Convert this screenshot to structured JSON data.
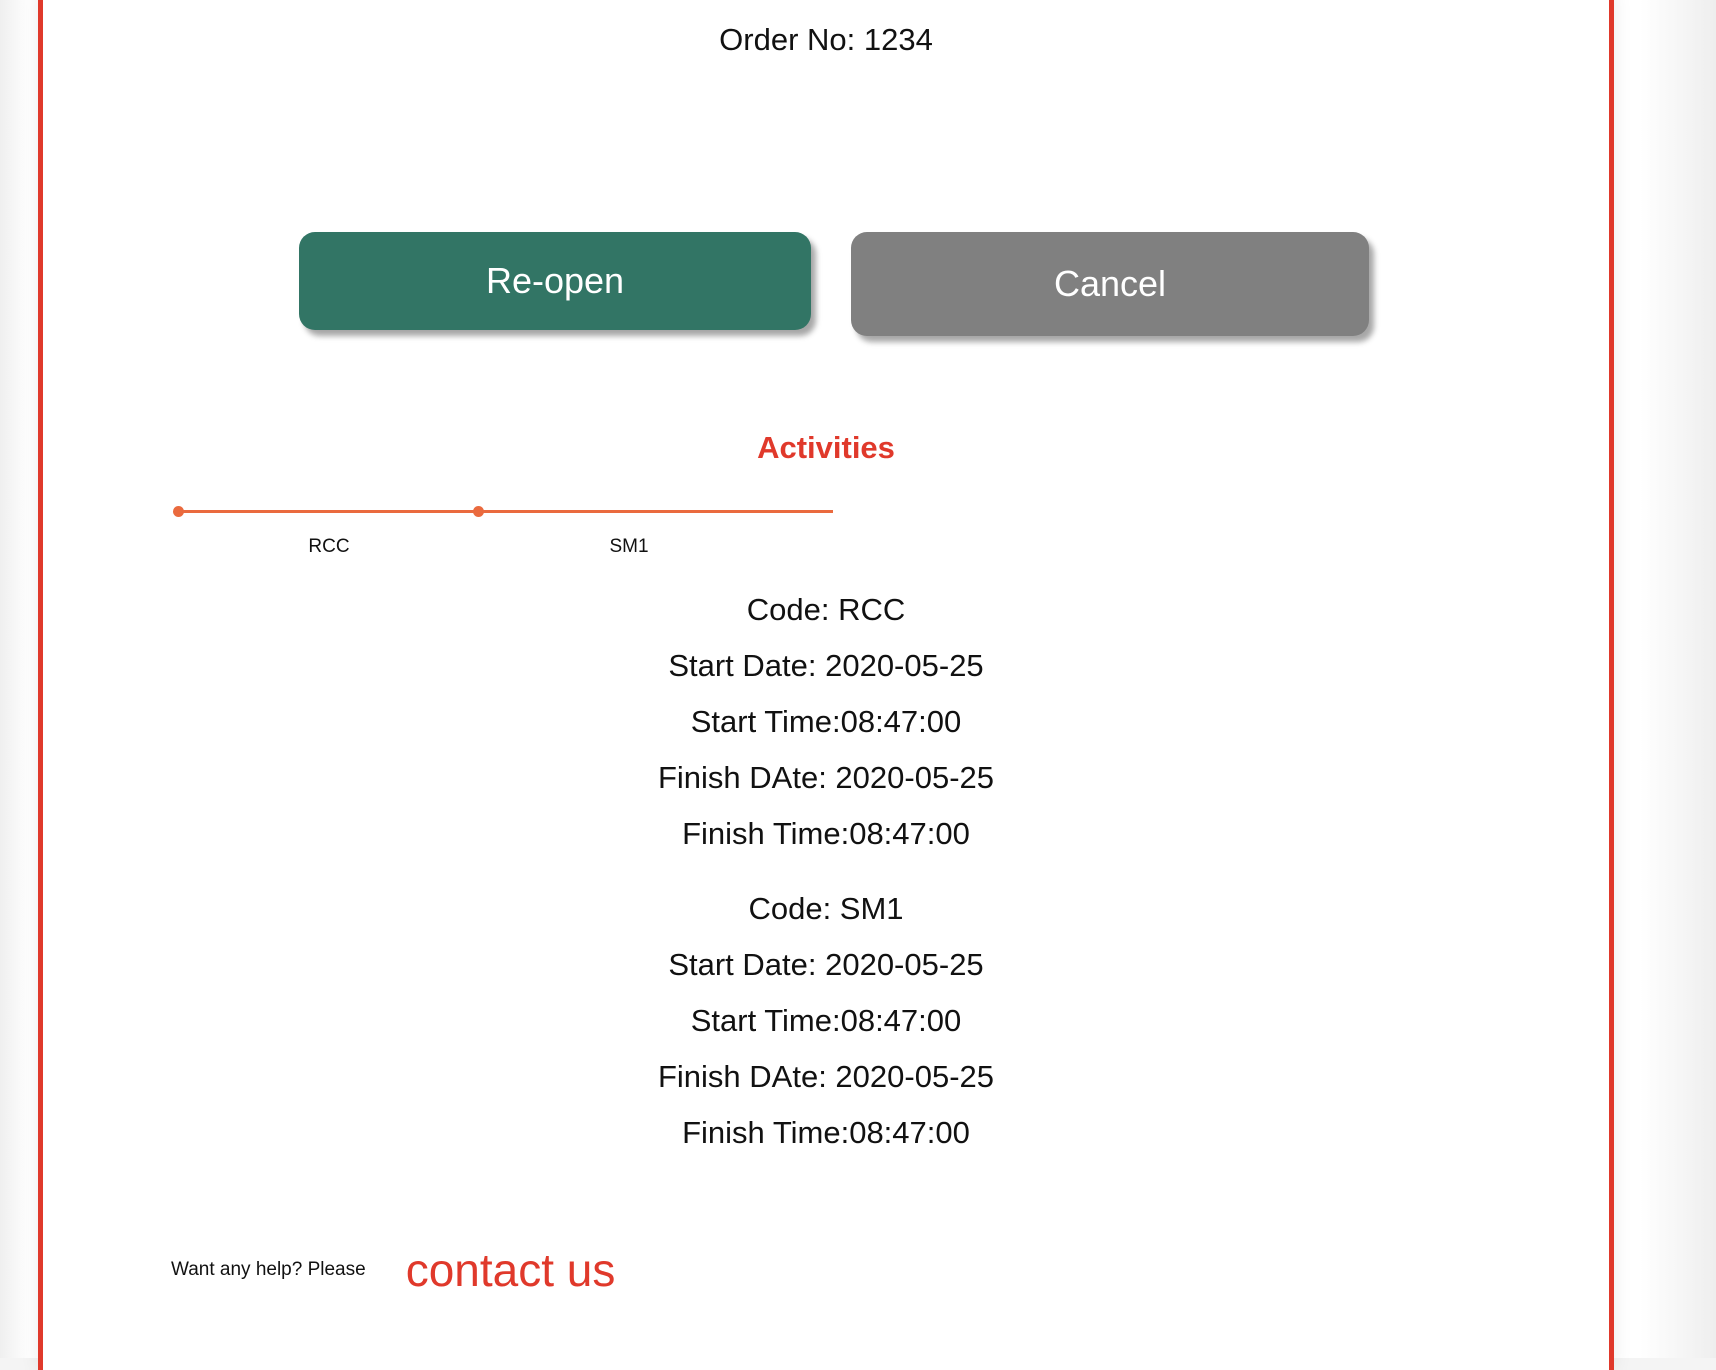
{
  "order": {
    "title": "Order No: 1234"
  },
  "actions": {
    "reopen_label": "Re-open",
    "cancel_label": "Cancel"
  },
  "activities": {
    "heading": "Activities",
    "timeline": [
      "RCC",
      "SM1"
    ],
    "items": [
      {
        "code": "Code: RCC",
        "start_date": "Start Date: 2020-05-25",
        "start_time": "Start Time:08:47:00",
        "finish_date": "Finish DAte: 2020-05-25",
        "finish_time": "Finish Time:08:47:00"
      },
      {
        "code": "Code: SM1",
        "start_date": "Start Date: 2020-05-25",
        "start_time": "Start Time:08:47:00",
        "finish_date": "Finish DAte: 2020-05-25",
        "finish_time": "Finish Time:08:47:00"
      }
    ]
  },
  "help": {
    "prompt": "Want any help? Please",
    "link_label": "contact us"
  },
  "colors": {
    "accent_red": "#e0392b",
    "reopen_green": "#327565",
    "cancel_gray": "#808080",
    "timeline_orange": "#ea6a3e"
  }
}
